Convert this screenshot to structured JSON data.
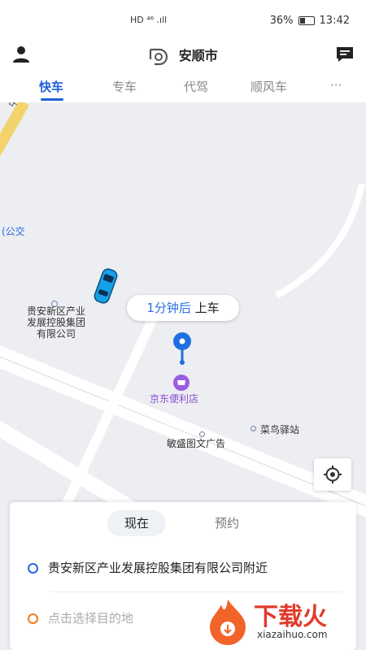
{
  "status": {
    "left_icons": "HD ⁴⁶ .ıll",
    "battery": "36%",
    "time": "13:42"
  },
  "header": {
    "title": "安顺市"
  },
  "tabs": [
    "快车",
    "专车",
    "代驾",
    "顺风车",
    "···"
  ],
  "map": {
    "labels": {
      "road": "中大道",
      "bus": "(公交",
      "company": [
        "贵安新区产业",
        "发展控股集团",
        "有限公司"
      ],
      "store": "京东便利店",
      "station": "菜鸟驿站",
      "ad": "敏盛图文广告"
    },
    "pickup": {
      "eta": "1分钟后",
      "action": "上车"
    }
  },
  "panel": {
    "mode_now": "现在",
    "mode_book": "预约",
    "origin": "贵安新区产业发展控股集团有限公司附近",
    "destination_placeholder": "点击选择目的地"
  },
  "watermark": {
    "brand": "下载火",
    "url": "xiazaihuo.com"
  },
  "colors": {
    "accent": "#2060d8",
    "origin_dot": "#2a66e0",
    "dest_dot": "#f07a1c"
  }
}
